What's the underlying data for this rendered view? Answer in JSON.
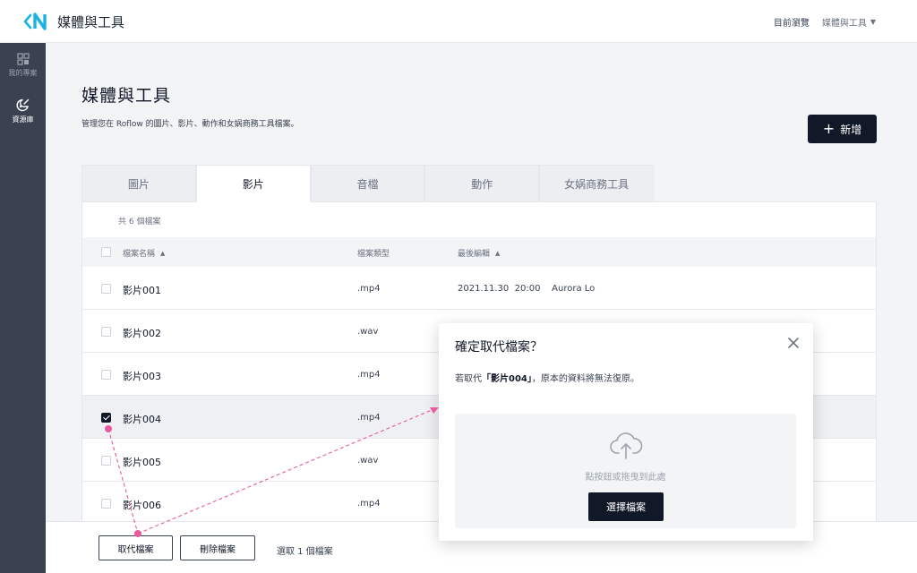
{
  "app": {
    "title": "媒體與工具"
  },
  "topbar": {
    "current_view_label": "目前瀏覽",
    "current_view_value": "媒體與工具"
  },
  "sidebar": {
    "items": [
      {
        "label": "我的專案",
        "icon": "grid-icon"
      },
      {
        "label": "資源庫",
        "icon": "palette-icon",
        "active": true
      }
    ]
  },
  "page": {
    "title": "媒體與工具",
    "description": "管理您在 Roflow 的圖片、影片、動作和女娲商務工具檔案。",
    "add_button": "新增"
  },
  "tabs": [
    {
      "label": "圖片"
    },
    {
      "label": "影片",
      "active": true
    },
    {
      "label": "音檔"
    },
    {
      "label": "動作"
    },
    {
      "label": "女娲商務工具"
    }
  ],
  "table": {
    "count_text": "共 6 個檔案",
    "headers": {
      "name": "檔案名稱",
      "type": "檔案類型",
      "edited": "最後編輯"
    },
    "rows": [
      {
        "name": "影片001",
        "type": ".mp4",
        "edited": "2021.11.30  20:00    Aurora Lo",
        "checked": false
      },
      {
        "name": "影片002",
        "type": ".wav",
        "edited": "",
        "checked": false
      },
      {
        "name": "影片003",
        "type": ".mp4",
        "edited": "",
        "checked": false
      },
      {
        "name": "影片004",
        "type": ".mp4",
        "edited": "",
        "checked": true
      },
      {
        "name": "影片005",
        "type": ".wav",
        "edited": "",
        "checked": false
      },
      {
        "name": "影片006",
        "type": ".mp4",
        "edited": "",
        "checked": false
      }
    ]
  },
  "bottom_bar": {
    "replace_button": "取代檔案",
    "delete_button": "刪除檔案",
    "selection_text": "選取 1 個檔案"
  },
  "modal": {
    "title": "確定取代檔案？",
    "message_prefix": "若取代",
    "message_file": "「影片004」",
    "message_suffix": "，原本的資料將無法復原。",
    "drop_hint": "點按鈕或拖曳到此處",
    "choose_button": "選擇檔案"
  },
  "colors": {
    "brand": "#1ab1e6",
    "accent": "#111827",
    "annotation": "#e85a9e"
  }
}
